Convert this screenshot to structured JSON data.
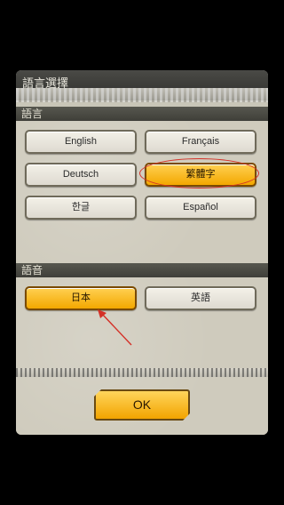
{
  "dialog": {
    "title": "語言選擇",
    "sections": {
      "display_language_header": "語言",
      "voice_language_header": "語音"
    }
  },
  "display_language": {
    "buttons": {
      "english": "English",
      "french": "Français",
      "german": "Deutsch",
      "traditional_chinese": "繁體字",
      "korean": "한글",
      "spanish": "Español"
    }
  },
  "voice_language": {
    "buttons": {
      "japanese": "日本",
      "english": "英語"
    }
  },
  "ok_button": "OK",
  "colors": {
    "selected_fill": "#f3a800",
    "annotation_red": "#d43128",
    "header_dark": "#3f3f39"
  },
  "icons": {
    "annotation_ellipse": "highlight-ellipse",
    "annotation_arrow": "red-arrow-icon"
  }
}
